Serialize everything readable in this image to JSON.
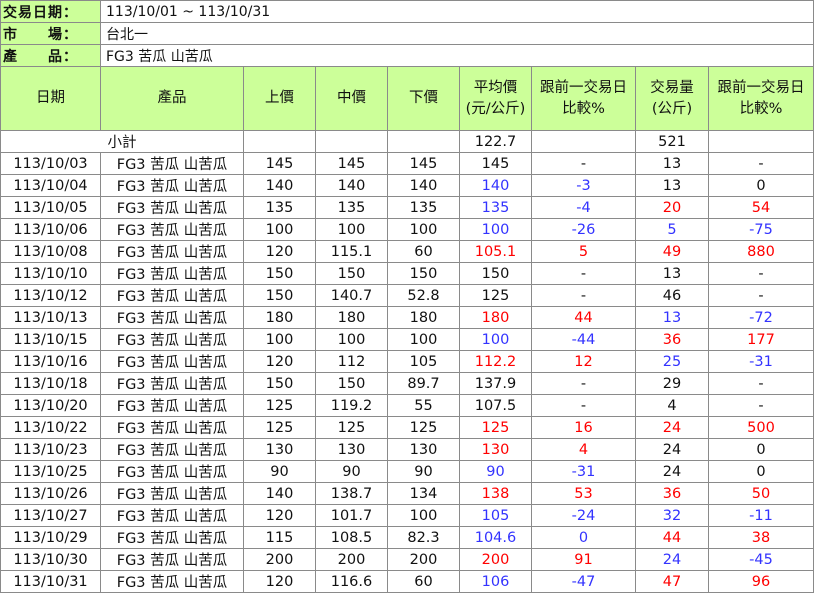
{
  "info": {
    "date_label": "交易日期：",
    "date_value": "113/10/01 ~ 113/10/31",
    "market_label": "市　　場：",
    "market_value": "台北一",
    "product_label": "產　　品：",
    "product_value": "FG3 苦瓜 山苦瓜"
  },
  "headers": {
    "date": "日期",
    "product": "產品",
    "high": "上價",
    "mid": "中價",
    "low": "下價",
    "avg_line1": "平均價",
    "avg_line2": "(元/公斤)",
    "avgcmp_line1": "跟前一交易日",
    "avgcmp_line2": "比較%",
    "vol_line1": "交易量",
    "vol_line2": "(公斤)",
    "volcmp_line1": "跟前一交易日",
    "volcmp_line2": "比較%"
  },
  "subtotal": {
    "label": "小計",
    "avg": "122.7",
    "vol": "521"
  },
  "colors": {
    "header_bg": "#ccff99",
    "blue": "#3333ff",
    "red": "#ff0000",
    "border": "#8a8a8a"
  },
  "rows": [
    {
      "date": "113/10/03",
      "product": "FG3 苦瓜 山苦瓜",
      "high": "145",
      "mid": "145",
      "low": "145",
      "avg": "145",
      "avg_c": "black",
      "avgcmp": "-",
      "avgcmp_c": "black",
      "vol": "13",
      "vol_c": "black",
      "volcmp": "-",
      "volcmp_c": "black"
    },
    {
      "date": "113/10/04",
      "product": "FG3 苦瓜 山苦瓜",
      "high": "140",
      "mid": "140",
      "low": "140",
      "avg": "140",
      "avg_c": "blue",
      "avgcmp": "-3",
      "avgcmp_c": "blue",
      "vol": "13",
      "vol_c": "black",
      "volcmp": "0",
      "volcmp_c": "black"
    },
    {
      "date": "113/10/05",
      "product": "FG3 苦瓜 山苦瓜",
      "high": "135",
      "mid": "135",
      "low": "135",
      "avg": "135",
      "avg_c": "blue",
      "avgcmp": "-4",
      "avgcmp_c": "blue",
      "vol": "20",
      "vol_c": "red",
      "volcmp": "54",
      "volcmp_c": "red"
    },
    {
      "date": "113/10/06",
      "product": "FG3 苦瓜 山苦瓜",
      "high": "100",
      "mid": "100",
      "low": "100",
      "avg": "100",
      "avg_c": "blue",
      "avgcmp": "-26",
      "avgcmp_c": "blue",
      "vol": "5",
      "vol_c": "blue",
      "volcmp": "-75",
      "volcmp_c": "blue"
    },
    {
      "date": "113/10/08",
      "product": "FG3 苦瓜 山苦瓜",
      "high": "120",
      "mid": "115.1",
      "low": "60",
      "avg": "105.1",
      "avg_c": "red",
      "avgcmp": "5",
      "avgcmp_c": "red",
      "vol": "49",
      "vol_c": "red",
      "volcmp": "880",
      "volcmp_c": "red"
    },
    {
      "date": "113/10/10",
      "product": "FG3 苦瓜 山苦瓜",
      "high": "150",
      "mid": "150",
      "low": "150",
      "avg": "150",
      "avg_c": "black",
      "avgcmp": "-",
      "avgcmp_c": "black",
      "vol": "13",
      "vol_c": "black",
      "volcmp": "-",
      "volcmp_c": "black"
    },
    {
      "date": "113/10/12",
      "product": "FG3 苦瓜 山苦瓜",
      "high": "150",
      "mid": "140.7",
      "low": "52.8",
      "avg": "125",
      "avg_c": "black",
      "avgcmp": "-",
      "avgcmp_c": "black",
      "vol": "46",
      "vol_c": "black",
      "volcmp": "-",
      "volcmp_c": "black"
    },
    {
      "date": "113/10/13",
      "product": "FG3 苦瓜 山苦瓜",
      "high": "180",
      "mid": "180",
      "low": "180",
      "avg": "180",
      "avg_c": "red",
      "avgcmp": "44",
      "avgcmp_c": "red",
      "vol": "13",
      "vol_c": "blue",
      "volcmp": "-72",
      "volcmp_c": "blue"
    },
    {
      "date": "113/10/15",
      "product": "FG3 苦瓜 山苦瓜",
      "high": "100",
      "mid": "100",
      "low": "100",
      "avg": "100",
      "avg_c": "blue",
      "avgcmp": "-44",
      "avgcmp_c": "blue",
      "vol": "36",
      "vol_c": "red",
      "volcmp": "177",
      "volcmp_c": "red"
    },
    {
      "date": "113/10/16",
      "product": "FG3 苦瓜 山苦瓜",
      "high": "120",
      "mid": "112",
      "low": "105",
      "avg": "112.2",
      "avg_c": "red",
      "avgcmp": "12",
      "avgcmp_c": "red",
      "vol": "25",
      "vol_c": "blue",
      "volcmp": "-31",
      "volcmp_c": "blue"
    },
    {
      "date": "113/10/18",
      "product": "FG3 苦瓜 山苦瓜",
      "high": "150",
      "mid": "150",
      "low": "89.7",
      "avg": "137.9",
      "avg_c": "black",
      "avgcmp": "-",
      "avgcmp_c": "black",
      "vol": "29",
      "vol_c": "black",
      "volcmp": "-",
      "volcmp_c": "black"
    },
    {
      "date": "113/10/20",
      "product": "FG3 苦瓜 山苦瓜",
      "high": "125",
      "mid": "119.2",
      "low": "55",
      "avg": "107.5",
      "avg_c": "black",
      "avgcmp": "-",
      "avgcmp_c": "black",
      "vol": "4",
      "vol_c": "black",
      "volcmp": "-",
      "volcmp_c": "black"
    },
    {
      "date": "113/10/22",
      "product": "FG3 苦瓜 山苦瓜",
      "high": "125",
      "mid": "125",
      "low": "125",
      "avg": "125",
      "avg_c": "red",
      "avgcmp": "16",
      "avgcmp_c": "red",
      "vol": "24",
      "vol_c": "red",
      "volcmp": "500",
      "volcmp_c": "red"
    },
    {
      "date": "113/10/23",
      "product": "FG3 苦瓜 山苦瓜",
      "high": "130",
      "mid": "130",
      "low": "130",
      "avg": "130",
      "avg_c": "red",
      "avgcmp": "4",
      "avgcmp_c": "red",
      "vol": "24",
      "vol_c": "black",
      "volcmp": "0",
      "volcmp_c": "black"
    },
    {
      "date": "113/10/25",
      "product": "FG3 苦瓜 山苦瓜",
      "high": "90",
      "mid": "90",
      "low": "90",
      "avg": "90",
      "avg_c": "blue",
      "avgcmp": "-31",
      "avgcmp_c": "blue",
      "vol": "24",
      "vol_c": "black",
      "volcmp": "0",
      "volcmp_c": "black"
    },
    {
      "date": "113/10/26",
      "product": "FG3 苦瓜 山苦瓜",
      "high": "140",
      "mid": "138.7",
      "low": "134",
      "avg": "138",
      "avg_c": "red",
      "avgcmp": "53",
      "avgcmp_c": "red",
      "vol": "36",
      "vol_c": "red",
      "volcmp": "50",
      "volcmp_c": "red"
    },
    {
      "date": "113/10/27",
      "product": "FG3 苦瓜 山苦瓜",
      "high": "120",
      "mid": "101.7",
      "low": "100",
      "avg": "105",
      "avg_c": "blue",
      "avgcmp": "-24",
      "avgcmp_c": "blue",
      "vol": "32",
      "vol_c": "blue",
      "volcmp": "-11",
      "volcmp_c": "blue"
    },
    {
      "date": "113/10/29",
      "product": "FG3 苦瓜 山苦瓜",
      "high": "115",
      "mid": "108.5",
      "low": "82.3",
      "avg": "104.6",
      "avg_c": "blue",
      "avgcmp": "0",
      "avgcmp_c": "blue",
      "vol": "44",
      "vol_c": "red",
      "volcmp": "38",
      "volcmp_c": "red"
    },
    {
      "date": "113/10/30",
      "product": "FG3 苦瓜 山苦瓜",
      "high": "200",
      "mid": "200",
      "low": "200",
      "avg": "200",
      "avg_c": "red",
      "avgcmp": "91",
      "avgcmp_c": "red",
      "vol": "24",
      "vol_c": "blue",
      "volcmp": "-45",
      "volcmp_c": "blue"
    },
    {
      "date": "113/10/31",
      "product": "FG3 苦瓜 山苦瓜",
      "high": "120",
      "mid": "116.6",
      "low": "60",
      "avg": "106",
      "avg_c": "blue",
      "avgcmp": "-47",
      "avgcmp_c": "blue",
      "vol": "47",
      "vol_c": "red",
      "volcmp": "96",
      "volcmp_c": "red"
    }
  ]
}
